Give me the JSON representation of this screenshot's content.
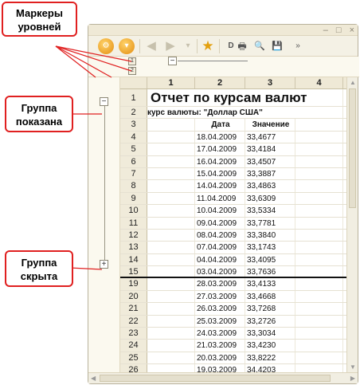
{
  "callouts": {
    "level_markers": {
      "line1": "Маркеры",
      "line2": "уровней"
    },
    "group_shown": {
      "line1": "Группа",
      "line2": "показана"
    },
    "group_hidden": {
      "line1": "Группа",
      "line2": "скрыта"
    }
  },
  "toolbar": {
    "save_glyph": "💾"
  },
  "outline": {
    "level_buttons": [
      "1",
      "2"
    ],
    "col_level_buttons": [
      "1",
      "2"
    ],
    "expanded_symbol": "−",
    "collapsed_symbol": "+"
  },
  "columns": [
    "1",
    "2",
    "3",
    "4"
  ],
  "report": {
    "title": "Отчет по курсам валют",
    "subtitle": "курс валюты: \"Доллар США\"",
    "col_date": "Дата",
    "col_value": "Значение"
  },
  "row_numbers": {
    "title": "1",
    "subtitle": "2",
    "header": "3"
  },
  "data_rows": [
    {
      "n": "4",
      "date": "18.04.2009",
      "value": "33,4677"
    },
    {
      "n": "5",
      "date": "17.04.2009",
      "value": "33,4184"
    },
    {
      "n": "6",
      "date": "16.04.2009",
      "value": "33,4507"
    },
    {
      "n": "7",
      "date": "15.04.2009",
      "value": "33,3887"
    },
    {
      "n": "8",
      "date": "14.04.2009",
      "value": "33,4863"
    },
    {
      "n": "9",
      "date": "11.04.2009",
      "value": "33,6309"
    },
    {
      "n": "10",
      "date": "10.04.2009",
      "value": "33,5334"
    },
    {
      "n": "11",
      "date": "09.04.2009",
      "value": "33,7781"
    },
    {
      "n": "12",
      "date": "08.04.2009",
      "value": "33,3840"
    },
    {
      "n": "13",
      "date": "07.04.2009",
      "value": "33,1743"
    },
    {
      "n": "14",
      "date": "04.04.2009",
      "value": "33,4095"
    },
    {
      "n": "15",
      "date": "03.04.2009",
      "value": "33,7636"
    },
    {
      "n": "19",
      "date": "28.03.2009",
      "value": "33,4133"
    },
    {
      "n": "20",
      "date": "27.03.2009",
      "value": "33,4668"
    },
    {
      "n": "21",
      "date": "26.03.2009",
      "value": "33,7268"
    },
    {
      "n": "22",
      "date": "25.03.2009",
      "value": "33,2726"
    },
    {
      "n": "23",
      "date": "24.03.2009",
      "value": "33,3034"
    },
    {
      "n": "24",
      "date": "21.03.2009",
      "value": "33,4230"
    },
    {
      "n": "25",
      "date": "20.03.2009",
      "value": "33,8222"
    },
    {
      "n": "26",
      "date": "19.03.2009",
      "value": "34,4203"
    }
  ],
  "colors": {
    "callout_border": "#e02020",
    "toolbar_orange": "#e38d10"
  }
}
